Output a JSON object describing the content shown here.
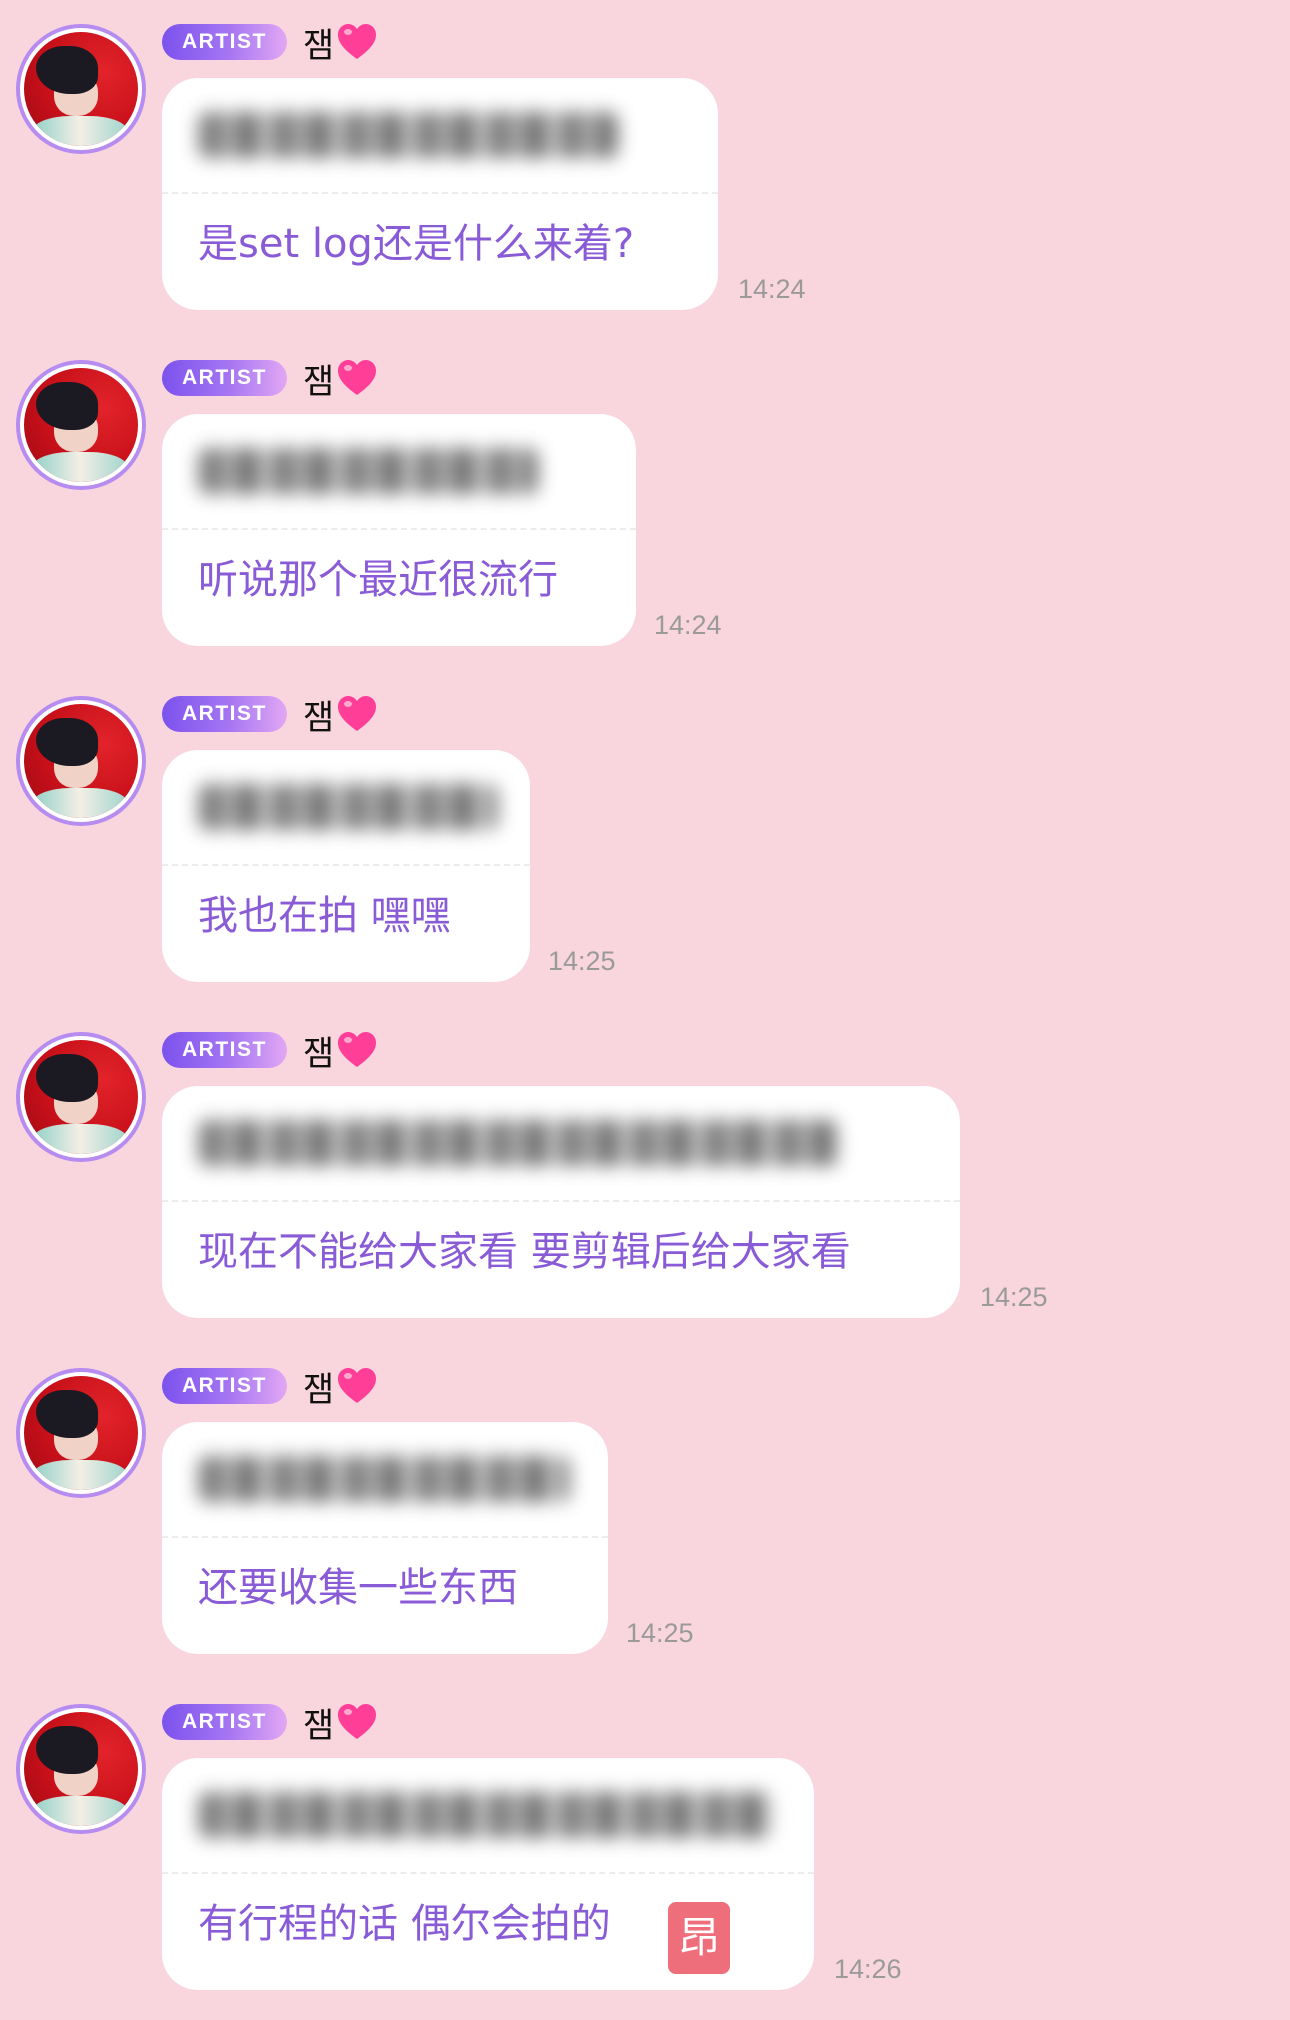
{
  "badge_label": "ARTIST",
  "sender_name": "잼",
  "icons": {
    "heart": "heart-icon",
    "avatar": "avatar-image"
  },
  "colors": {
    "background": "#f9d6de",
    "translation_text": "#8a5bd6",
    "badge_gradient_start": "#7c52ee",
    "badge_gradient_end": "#e2a7f4",
    "heart": "#ff3e97",
    "timestamp": "#9a9a9a"
  },
  "messages": [
    {
      "translation": "是set log还是什么来着?",
      "time": "14:24"
    },
    {
      "translation": "听说那个最近很流行",
      "time": "14:24"
    },
    {
      "translation": "我也在拍 嘿嘿",
      "time": "14:25"
    },
    {
      "translation": "现在不能给大家看 要剪辑后给大家看",
      "time": "14:25"
    },
    {
      "translation": "还要收集一些东西",
      "time": "14:25"
    },
    {
      "translation": "有行程的话 偶尔会拍的",
      "time": "14:26",
      "sticker_text": "昂"
    }
  ]
}
